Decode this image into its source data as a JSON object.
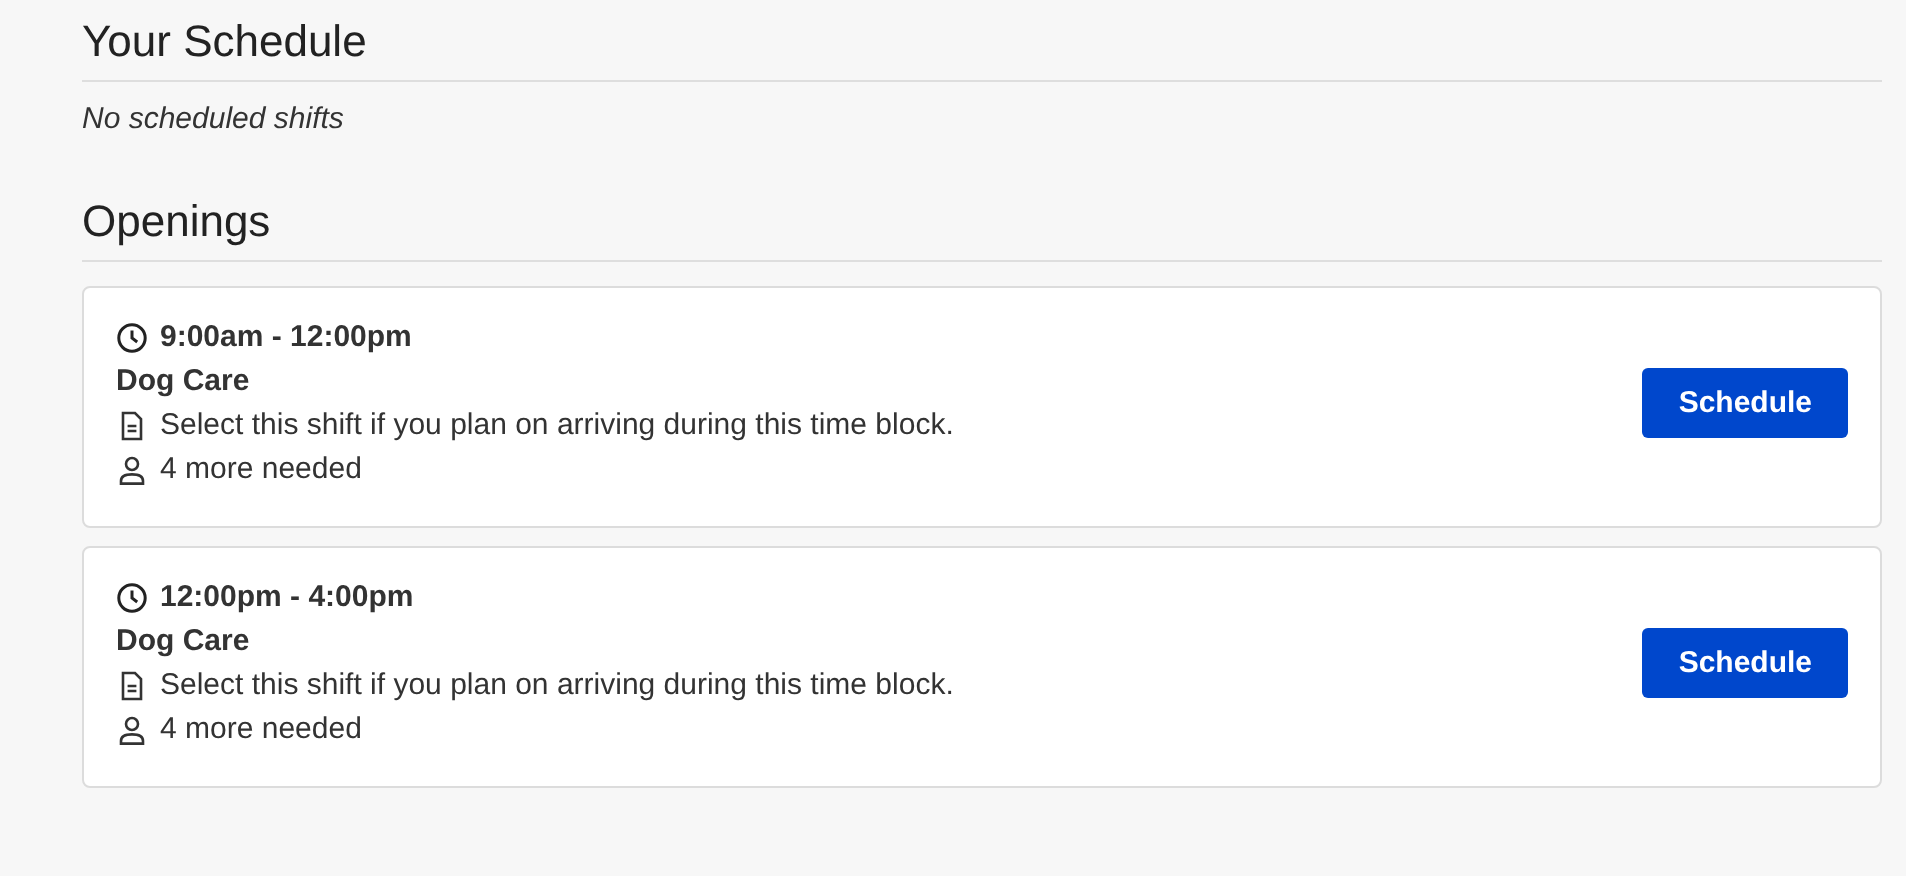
{
  "schedule": {
    "title": "Your Schedule",
    "empty_message": "No scheduled shifts"
  },
  "openings": {
    "title": "Openings",
    "shifts": [
      {
        "time": "9:00am - 12:00pm",
        "name": "Dog Care",
        "description": "Select this shift if you plan on arriving during this time block.",
        "needed": "4 more needed",
        "button": "Schedule"
      },
      {
        "time": "12:00pm - 4:00pm",
        "name": "Dog Care",
        "description": "Select this shift if you plan on arriving during this time block.",
        "needed": "4 more needed",
        "button": "Schedule"
      }
    ]
  }
}
